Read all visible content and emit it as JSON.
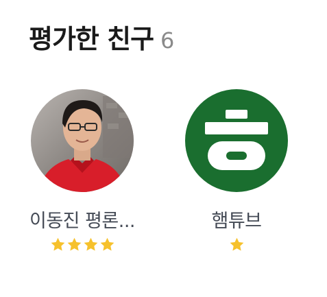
{
  "section": {
    "title": "평가한 친구",
    "count": "6"
  },
  "colors": {
    "star": "#f6c12c",
    "logo_green": "#1a6e2f",
    "title": "#1a1a1a",
    "count": "#8a8a8a",
    "name": "#444a55"
  },
  "friends": [
    {
      "name": "이동진 평론...",
      "avatar": "person-photo",
      "rating": 4
    },
    {
      "name": "햄튜브",
      "avatar": "hieut-logo-icon",
      "rating": 1
    }
  ]
}
